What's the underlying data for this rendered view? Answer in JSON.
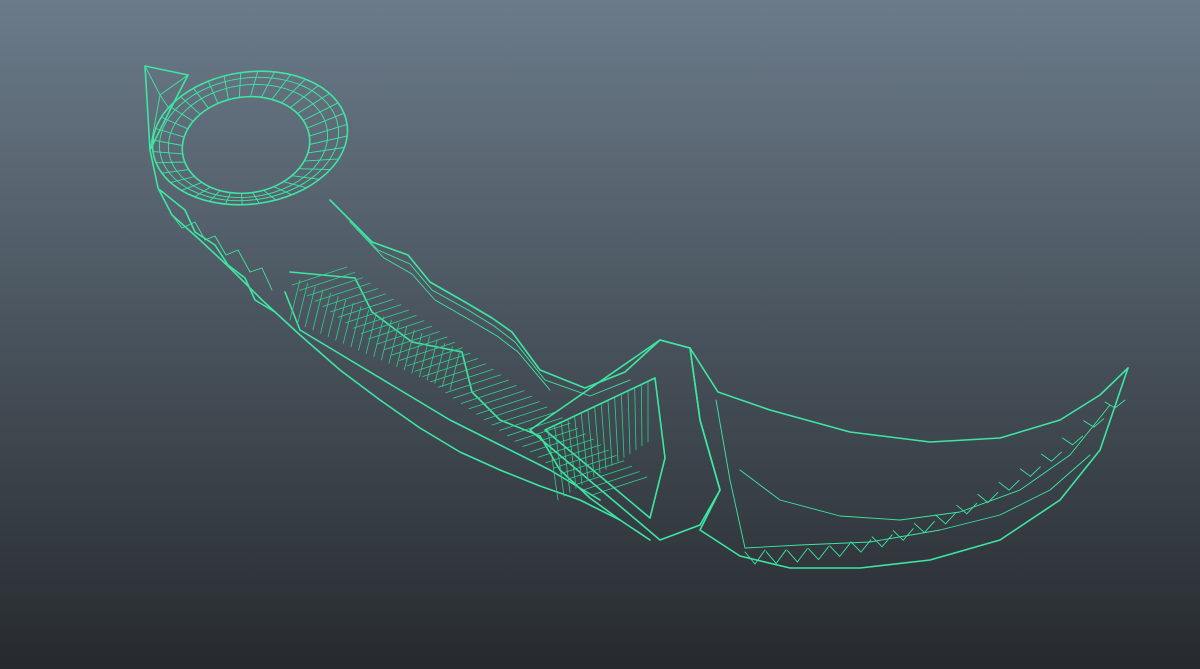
{
  "viewport": {
    "background_top": "#6b7b8a",
    "background_bottom": "#262a2e"
  },
  "model": {
    "object": "karambit-knife-mesh",
    "display_mode": "wireframe",
    "wire_color": "#3ee6a3",
    "wire_color_dim": "#2fcf8f"
  }
}
